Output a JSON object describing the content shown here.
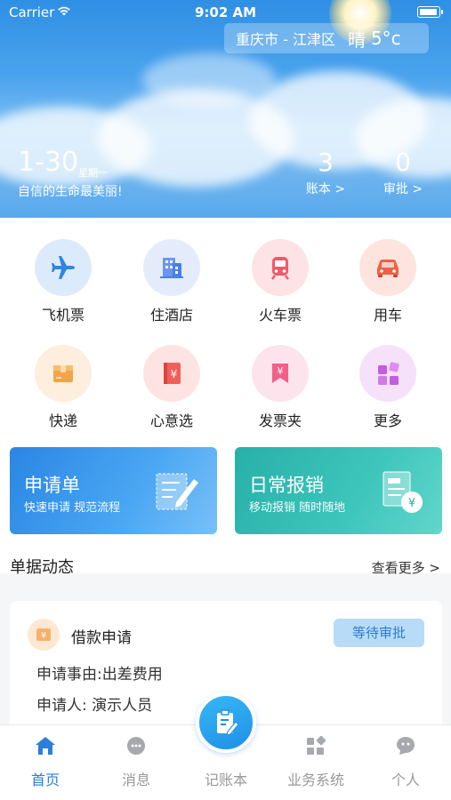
{
  "status_bar": {
    "carrier": "Carrier",
    "time": "9:02 AM",
    "battery_level": 0.95
  },
  "weather": {
    "location": "重庆市 - 江津区",
    "condition": "晴",
    "temperature": "5°c"
  },
  "date": {
    "day": "1-30",
    "weekday": "星期一",
    "motto": "自信的生命最美丽!"
  },
  "stats": [
    {
      "value": "3",
      "label": "账本 >"
    },
    {
      "value": "0",
      "label": "审批 >"
    }
  ],
  "apps": [
    {
      "label": "飞机票",
      "icon": "airplane-icon",
      "color": "#2f86e0",
      "bg": "#dcebfb"
    },
    {
      "label": "住酒店",
      "icon": "hotel-icon",
      "color": "#4b7fe8",
      "bg": "#e4ecfb"
    },
    {
      "label": "火车票",
      "icon": "train-icon",
      "color": "#ef5b6b",
      "bg": "#fde3e6"
    },
    {
      "label": "用车",
      "icon": "car-icon",
      "color": "#f06046",
      "bg": "#fde4df"
    },
    {
      "label": "快递",
      "icon": "package-icon",
      "color": "#f2a548",
      "bg": "#fdeedd"
    },
    {
      "label": "心意选",
      "icon": "gift-book-icon",
      "color": "#f0605a",
      "bg": "#fde4e2"
    },
    {
      "label": "发票夹",
      "icon": "invoice-icon",
      "color": "#f0618a",
      "bg": "#fde3ec"
    },
    {
      "label": "更多",
      "icon": "more-grid-icon",
      "color": "#c35ee0",
      "bg": "#f5e2fa"
    }
  ],
  "cards": [
    {
      "title": "申请单",
      "subtitle": "快速申请 规范流程",
      "icon": "form-edit-icon"
    },
    {
      "title": "日常报销",
      "subtitle": "移动报销 随时随地",
      "icon": "reimburse-icon"
    }
  ],
  "section": {
    "title": "单据动态",
    "more": "查看更多 >"
  },
  "document": {
    "title": "借款申请",
    "status": "等待审批",
    "reason_label": "申请事由:出差费用",
    "applicant_label": "申请人: 演示人员"
  },
  "tabs": [
    {
      "label": "首页",
      "icon": "home-icon",
      "active": true
    },
    {
      "label": "消息",
      "icon": "message-icon",
      "active": false
    },
    {
      "label": "记账本",
      "icon": "notebook-icon",
      "active": false
    },
    {
      "label": "业务系统",
      "icon": "apps-icon",
      "active": false
    },
    {
      "label": "个人",
      "icon": "profile-icon",
      "active": false
    }
  ],
  "colors": {
    "accent": "#2b7fd8",
    "card_blue": "#2e8fe6",
    "card_teal": "#2fb9b0"
  }
}
